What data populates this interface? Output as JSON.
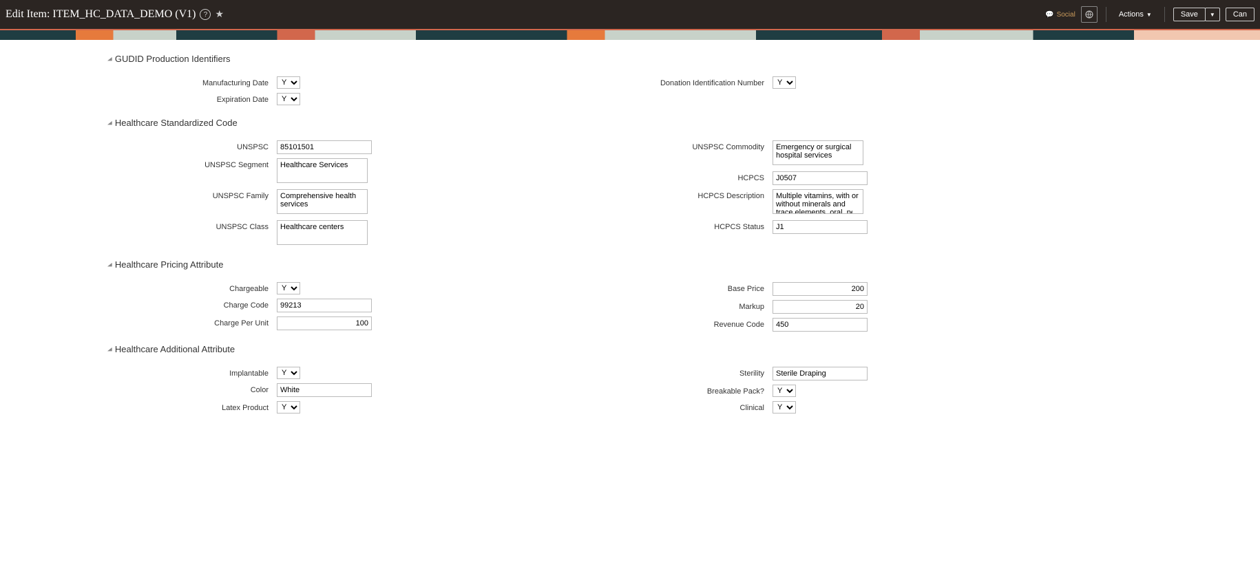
{
  "header": {
    "title": "Edit Item: ITEM_HC_DATA_DEMO (V1)",
    "social_label": "Social",
    "actions_label": "Actions",
    "save_label": "Save",
    "cancel_label": "Can"
  },
  "yn": {
    "Y": "Y"
  },
  "sections": {
    "gudid": {
      "title": "GUDID Production Identifiers",
      "manufacturing_date_label": "Manufacturing Date",
      "manufacturing_date_value": "Y",
      "expiration_date_label": "Expiration Date",
      "expiration_date_value": "Y",
      "donation_id_label": "Donation Identification Number",
      "donation_id_value": "Y"
    },
    "codes": {
      "title": "Healthcare Standardized Code",
      "unspsc_label": "UNSPSC",
      "unspsc_value": "85101501",
      "unspsc_segment_label": "UNSPSC Segment",
      "unspsc_segment_value": "Healthcare Services",
      "unspsc_family_label": "UNSPSC Family",
      "unspsc_family_value": "Comprehensive health services",
      "unspsc_class_label": "UNSPSC Class",
      "unspsc_class_value": "Healthcare centers",
      "unspsc_commodity_label": "UNSPSC Commodity",
      "unspsc_commodity_value": "Emergency or surgical hospital services",
      "hcpcs_label": "HCPCS",
      "hcpcs_value": "J0507",
      "hcpcs_desc_label": "HCPCS Description",
      "hcpcs_desc_value": "Multiple vitamins, with or without minerals and trace elements, oral, per dose",
      "hcpcs_status_label": "HCPCS Status",
      "hcpcs_status_value": "J1"
    },
    "pricing": {
      "title": "Healthcare Pricing Attribute",
      "chargeable_label": "Chargeable",
      "chargeable_value": "Y",
      "charge_code_label": "Charge Code",
      "charge_code_value": "99213",
      "charge_per_unit_label": "Charge Per Unit",
      "charge_per_unit_value": "100",
      "base_price_label": "Base Price",
      "base_price_value": "200",
      "markup_label": "Markup",
      "markup_value": "20",
      "revenue_code_label": "Revenue Code",
      "revenue_code_value": "450"
    },
    "additional": {
      "title": "Healthcare Additional Attribute",
      "implantable_label": "Implantable",
      "implantable_value": "Y",
      "color_label": "Color",
      "color_value": "White",
      "latex_label": "Latex Product",
      "latex_value": "Y",
      "sterility_label": "Sterility",
      "sterility_value": "Sterile Draping",
      "breakable_label": "Breakable Pack?",
      "breakable_value": "Y",
      "clinical_label": "Clinical",
      "clinical_value": "Y"
    }
  }
}
